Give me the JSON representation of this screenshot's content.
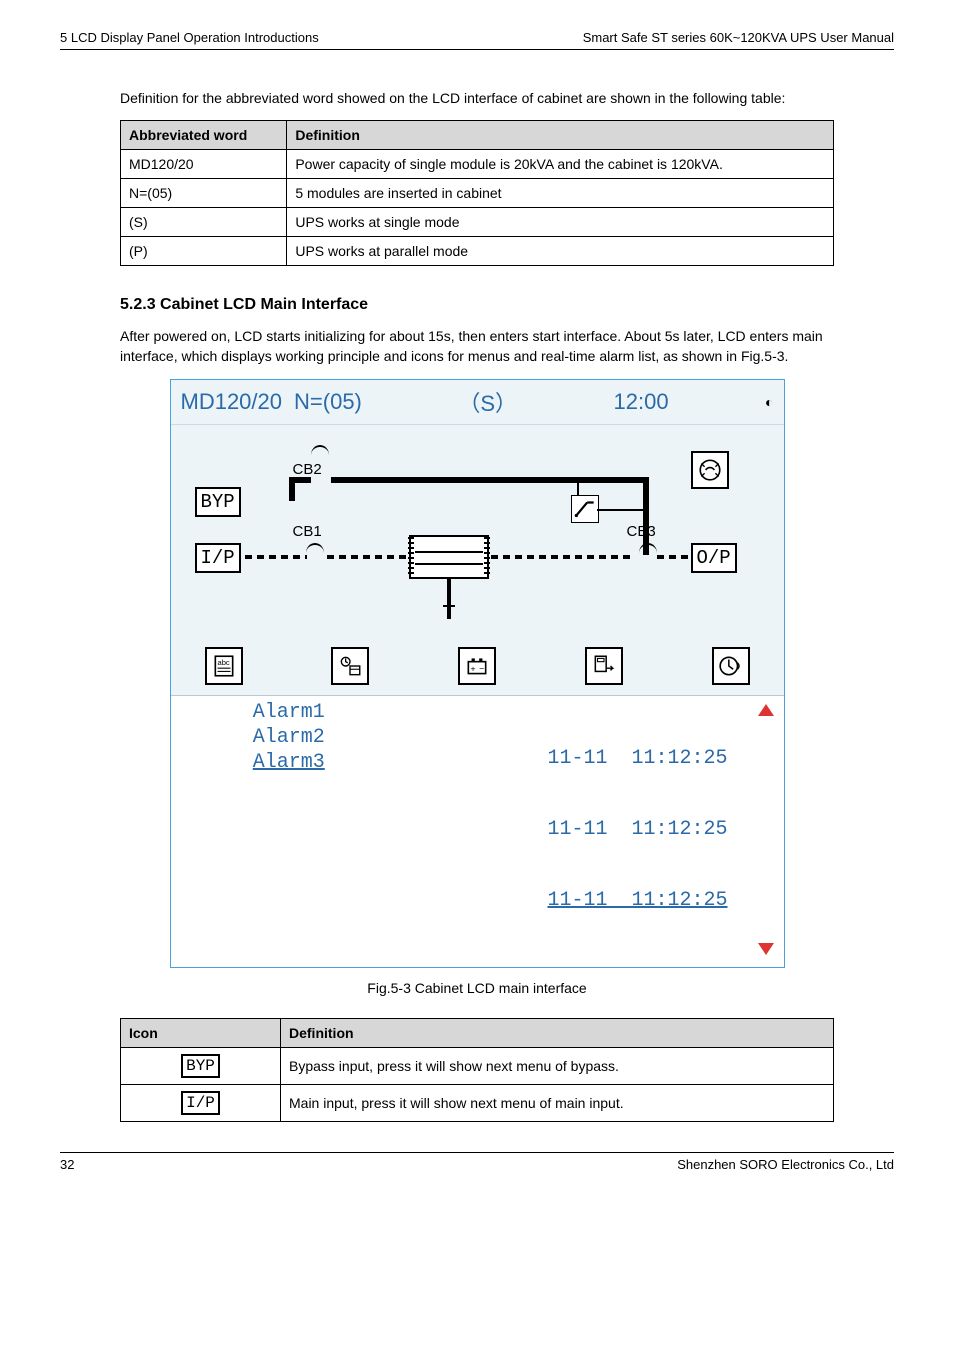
{
  "page": {
    "header_left": "5 LCD Display Panel Operation Introductions",
    "header_right": "Smart Safe ST series 60K~120KVA UPS User Manual",
    "footer_left": "32",
    "footer_right": "Shenzhen SORO Electronics Co., Ltd"
  },
  "intro_text": "Definition for the abbreviated word showed on the LCD interface of cabinet are shown in the following table:",
  "defs1": {
    "col1": "Abbreviated word",
    "col2": "Definition",
    "rows": [
      {
        "abbr": "MD120/20",
        "def": "Power capacity of single module is 20kVA and the cabinet is 120kVA."
      },
      {
        "abbr": "N=(05)",
        "def": "5 modules are inserted in cabinet"
      },
      {
        "abbr": "(S)",
        "def": "UPS works at single mode"
      },
      {
        "abbr": "(P)",
        "def": "UPS works at parallel mode"
      }
    ]
  },
  "section": {
    "heading": "5.2.3 Cabinet LCD Main Interface",
    "para1": "After powered on, LCD starts initializing for about 15s, then enters start interface. About 5s later, LCD enters main interface, which displays working principle and icons for menus and real-time alarm list, as shown in Fig.5-3.",
    "fig": {
      "top": {
        "model": "MD120/20",
        "n": "N=(05)",
        "mode": "（S）",
        "time": "12:00",
        "dot": "◐"
      },
      "labels": {
        "byp": "BYP",
        "ip": "I/P",
        "op": "O/P",
        "cb1": "CB1",
        "cb2": "CB2",
        "cb3": "CB3"
      },
      "alarms": {
        "row1_left": "Alarm1",
        "row2_left": "Alarm2",
        "row3_left": "Alarm3",
        "row1_right": "11-11  11:12:25",
        "row2_right": "11-11  11:12:25",
        "row3_right": "11-11  11:12:25"
      }
    },
    "caption": "Fig.5-3 Cabinet LCD main interface"
  },
  "defs2": {
    "col1": "Icon",
    "col2": "Definition",
    "rows": [
      {
        "icon": "BYP",
        "def": "Bypass input, press it will show next menu of bypass."
      },
      {
        "icon": "I/P",
        "def": "Main input, press it will show next menu of main input."
      }
    ]
  }
}
